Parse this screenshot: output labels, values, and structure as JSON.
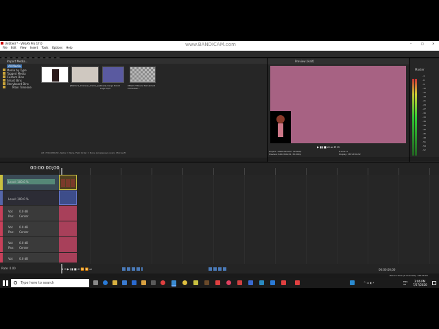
{
  "watermark": "www.BANDICAM.com",
  "window": {
    "title": "Untitled * - VEGAS Pro 17.0",
    "controls": [
      "–",
      "□",
      "✕"
    ]
  },
  "menu": [
    "File",
    "Edit",
    "View",
    "Insert",
    "Tools",
    "Options",
    "Help"
  ],
  "project_media": {
    "toolbar_label": "Import Media...",
    "tree": [
      "All Media",
      "Media by Type",
      "Tagged Media",
      "Custom Bins",
      "Smart Bins",
      "Storyboard Bins",
      "Main Timeline"
    ],
    "items": [
      {
        "name": "",
        "color": "#ffffff"
      },
      {
        "name": "[Wiktor's_Channel_Anime_part_1]_Youtube5em...",
        "color": "#cfc8c0"
      },
      {
        "name": "Roady-Cergo Robot Logo.mp4",
        "color": "#5a5aa0"
      },
      {
        "name": "VEGAS Titles & Text (Kmod Camedian...",
        "color": "#888888"
      }
    ],
    "status": "Alt: 720×480x32, Alpha = None, Field Order = None (progressive scan), Microsoft"
  },
  "bottom_tabs": [
    "Project Media",
    "Explorer",
    "Transitions",
    "Video FX",
    "Media Generators",
    "Project Notes"
  ],
  "preview": {
    "label": "Preview (Half)",
    "project": "Project:   1280x720x32, 30.000p",
    "preview": "Preview:   640x360x32, 30.000p",
    "display": "Display:   587x330x32",
    "frame": "Frame:     0",
    "tabs": [
      "Video Preview",
      "Trimmer"
    ],
    "bg_color": "#a76283"
  },
  "master": {
    "label": "Master",
    "bus_tab": "Master Bus",
    "levels": [
      "-3",
      "-6",
      "-9",
      "-12",
      "-15",
      "-18",
      "-21",
      "-24",
      "-27",
      "-30",
      "-33",
      "-36",
      "-39",
      "-42",
      "-45",
      "-48",
      "-51",
      "-54",
      "-57"
    ]
  },
  "timeline": {
    "timecode": "00:00:00;00",
    "video_track": {
      "level": "Level: 100.0 %"
    },
    "video_track2": {
      "level": "Level: 100.0 %"
    },
    "audio_tracks": [
      {
        "vol": "Vol:",
        "vol_val": "0.0 dB",
        "pan": "Pan:",
        "pan_val": "Center"
      },
      {
        "vol": "Vol:",
        "vol_val": "0.0 dB",
        "pan": "Pan:",
        "pan_val": "Center"
      },
      {
        "vol": "Vol:",
        "vol_val": "0.0 dB",
        "pan": "Pan:",
        "pan_val": "Center"
      },
      {
        "vol": "Vol:",
        "vol_val": "0.0 dB",
        "pan": "",
        "pan_val": ""
      }
    ],
    "rate": "Rate: 0.00",
    "end_time": "00:00:00;00"
  },
  "status_bar": {
    "record_time": "Record Time (2 channels): 136:35:00"
  },
  "taskbar": {
    "search_placeholder": "Type here to search",
    "lang": "ENG\nUS",
    "time": "3:06 PM",
    "date": "7/27/2020"
  },
  "colors": {
    "accent_video": "#c8c040",
    "audio_clip": "#a8405a",
    "preview": "#a76283"
  }
}
